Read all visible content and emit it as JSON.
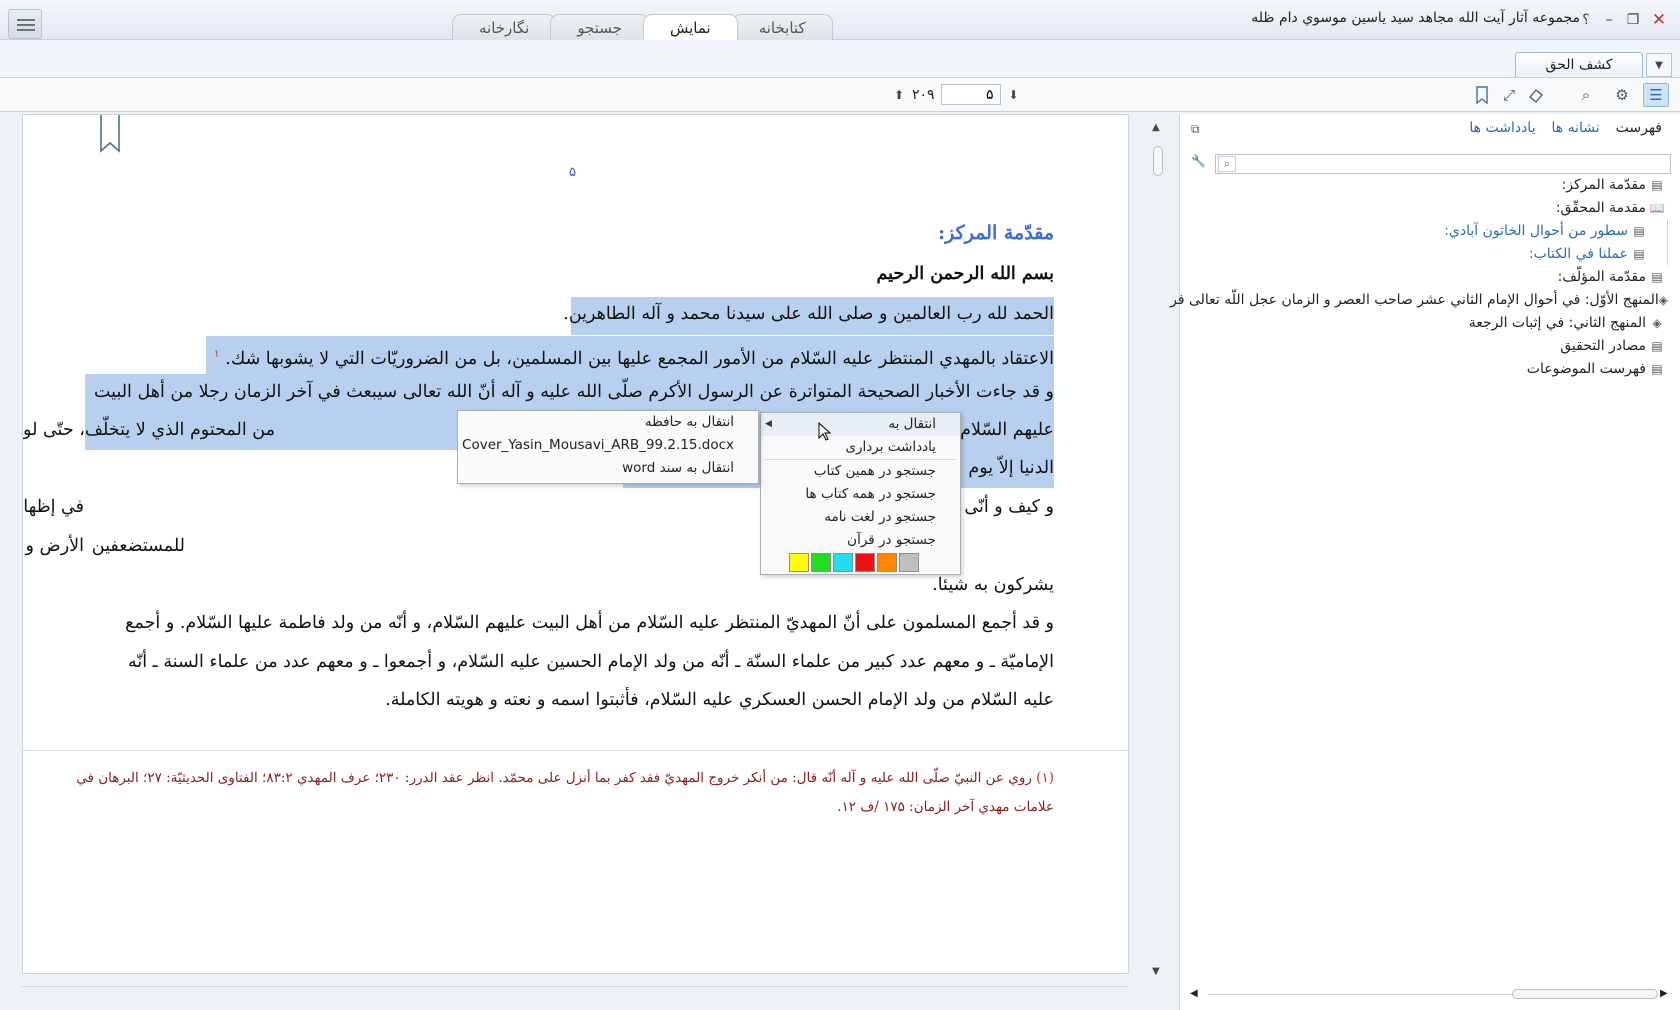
{
  "window": {
    "title": "مجموعه آثار آيت الله مجاهد سيد ياسين موسوي دام ظله",
    "help_label": "؟",
    "minimize_label": "–",
    "maximize_label": "❐",
    "close_label": "✕"
  },
  "tabs": [
    {
      "label": "نگارخانه",
      "active": false
    },
    {
      "label": "جستجو",
      "active": false
    },
    {
      "label": "نمايش",
      "active": true
    },
    {
      "label": "كتابخانه",
      "active": false
    }
  ],
  "book_tab": {
    "label": "كشف الحق"
  },
  "pager": {
    "current": "۵",
    "total": "۲۰۹"
  },
  "toolbar_icons": [
    "bookmark-icon",
    "fullscreen-icon",
    "eraser-icon",
    "search-icon",
    "settings-icon",
    "list-icon"
  ],
  "page": {
    "page_number": "۵",
    "heading": "مقدّمة المركز:",
    "basmala": "بسم الله الرحمن الرحيم",
    "lines": [
      "الحمد لله رب العالمين و صلى الله على سيدنا محمد و آله الطاهرين.",
      "الاعتقاد بالمهدي المنتظر عليه السّلام من الأمور المجمع عليها بين المسلمين، بل من الضروريّات التي لا يشوبها شك.",
      "و قد جاءت الأخبار الصحيحة المتواترة عن الرسول الأكرم صلّى الله عليه و آله أنّ الله تعالى سيبعث في آخر الزمان رجلا من أهل البيت",
      "عليهم السّلام",
      "من المحتوم الذي لا يتخلّف، حتّى لو لم يبق من",
      "الدنيا إلاّ يوم",
      "و كيف و أنّى",
      "في إظهار دينه على الدين كلّه و لو كره المشركون؟ و كيف لا يحقّق ـ تعالى ـ وعده",
      "للمستضعفين",
      "الأرض و بتمكين دينهم الذي ارتضى لهم، و إبدالهم من بعد خوفهم أمنا، ليعبدونه ـ تعالى ـ لا",
      "يشركون به شيئا.",
      "و قد أجمع المسلمون على أنّ المهديّ المنتظر عليه السّلام من أهل البيت عليهم السّلام، و أنّه من ولد فاطمة عليها السّلام. و أجمع",
      "الإماميّة ـ و معهم عدد كبير من علماء السنّة ـ أنّه من ولد الإمام الحسين عليه السّلام، و أجمعوا ـ و معهم عدد من علماء السنة ـ أنّه",
      "عليه السّلام من ولد الإمام الحسن العسكري عليه السّلام، فأثبتوا اسمه و نعته و هويته الكاملة."
    ],
    "footnote_marker": "١",
    "footnote_num": "(١)",
    "footnote_line1": "روي عن النبيّ صلّى الله عليه و آله أنّه قال: من أنكر خروج المهديّ فقد كفر بما أنزل على محمّد. انظر عقد الدرر: ۲۳۰؛ عرف المهدي ۸۳:۲؛ الفتاوى الحديثيّة: ۲۷؛ البرهان في",
    "footnote_line2": "علامات مهدي آخر الزمان: ۱۷۵ /ف ۱۲."
  },
  "panel": {
    "tabs": [
      {
        "label": "فهرست",
        "active": true
      },
      {
        "label": "نشانه ها",
        "active": false
      },
      {
        "label": "يادداشت ها",
        "active": false
      }
    ],
    "search_placeholder": "",
    "toc": [
      {
        "label": "مقدّمة المركز:",
        "icon": "page-icon",
        "child": false
      },
      {
        "label": "مقدمة المحقّق:",
        "icon": "open-book-icon",
        "child": false
      },
      {
        "label": "سطور من أحوال الخاتون آبادي:",
        "icon": "page-icon",
        "child": true
      },
      {
        "label": "عملنا في الكتاب:",
        "icon": "page-icon",
        "child": true
      },
      {
        "label": "مقدّمة المؤلّف:",
        "icon": "page-icon",
        "child": false
      },
      {
        "label": "المنهج الأوّل: في أحوال الإمام الثاني عشر صاحب العصر و الزمان عجل اللّه تعالى فر",
        "icon": "stack-icon",
        "child": false
      },
      {
        "label": "المنهج الثاني: في إثبات الرجعة",
        "icon": "stack-icon",
        "child": false
      },
      {
        "label": "مصادر التحقيق",
        "icon": "page-icon",
        "child": false
      },
      {
        "label": "فهرست الموضوعات",
        "icon": "page-icon",
        "child": false
      }
    ]
  },
  "context_menu": {
    "items": [
      "انتقال به",
      "يادداشت برداری",
      "جستجو در همين کتاب",
      "جستجو در همه کتاب ها",
      "جستجو در لغت نامه",
      "جستجو در قرآن"
    ],
    "highlight_colors": [
      "#ffff00",
      "#22dd22",
      "#22ddee",
      "#ee1111",
      "#ff8800",
      "#c0c0c0"
    ],
    "submenu": [
      "انتقال به حافظه",
      "Cover_Yasin_Mousavi_ARB_99.2.15.docx",
      "انتقال به سند word"
    ]
  }
}
